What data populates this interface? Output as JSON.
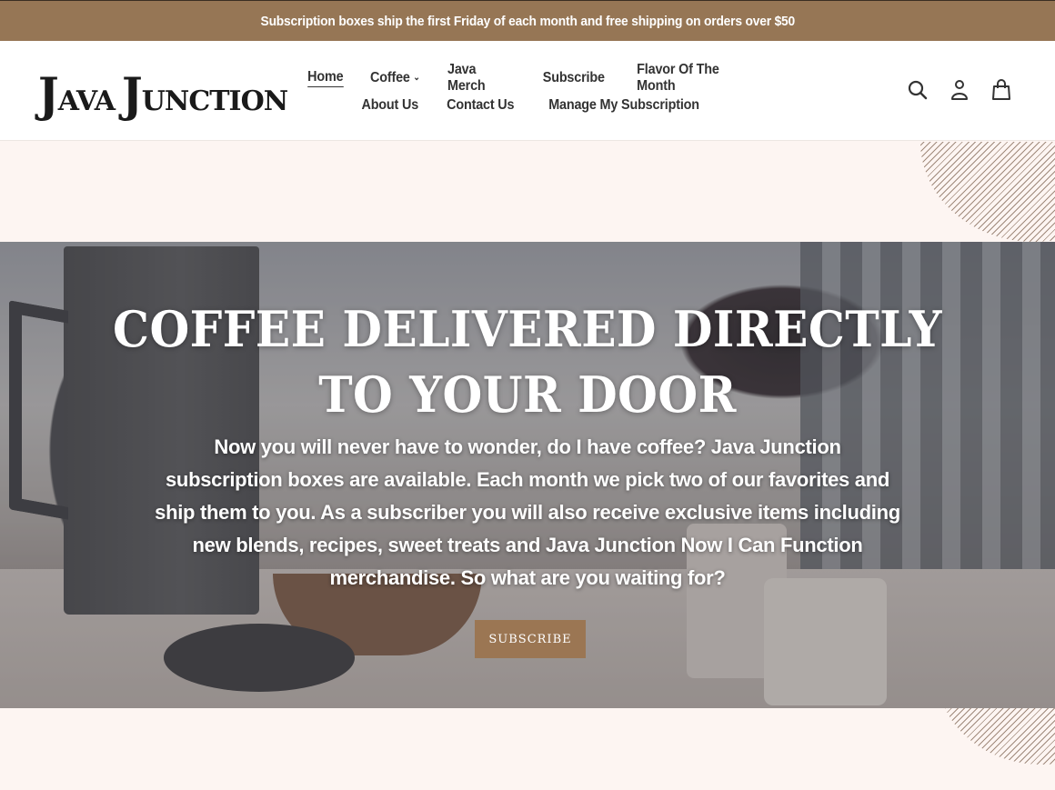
{
  "announcement": {
    "text": "Subscription boxes ship the first Friday of each month and free shipping on orders over $50",
    "background": "#967655"
  },
  "header": {
    "logo": {
      "word1_initial": "J",
      "word1_rest": "AVA",
      "word2_initial": "J",
      "word2_rest": "UNCTION",
      "alt": "Java Junction"
    },
    "nav": {
      "row1": [
        {
          "label": "Home",
          "active": true
        },
        {
          "label": "Coffee",
          "has_dropdown": true,
          "dropdown_icon": "chevron-down-icon"
        },
        {
          "label": "Java Merch"
        },
        {
          "label": "Subscribe"
        },
        {
          "label": "Flavor Of The Month"
        }
      ],
      "row2": [
        {
          "label": "About Us"
        },
        {
          "label": "Contact Us"
        },
        {
          "label": "Manage My Subscription"
        }
      ]
    },
    "icons": [
      "search-icon",
      "account-icon",
      "cart-icon"
    ]
  },
  "hero": {
    "title": "COFFEE DELIVERED DIRECTLY TO YOUR DOOR",
    "text": "Now you will never have to wonder, do I have coffee? Java Junction subscription boxes are available. Each month we pick two of our favorites and ship them to you. As a subscriber you will also receive exclusive items including new blends, recipes, sweet treats and Java Junction Now I Can Function merchandise. So what are you waiting for?",
    "button_label": "SUBSCRIBE",
    "button_color": "#9b7653"
  },
  "colors": {
    "page_background": "#fdf5f2",
    "accent": "#967655",
    "text": "#333333"
  }
}
